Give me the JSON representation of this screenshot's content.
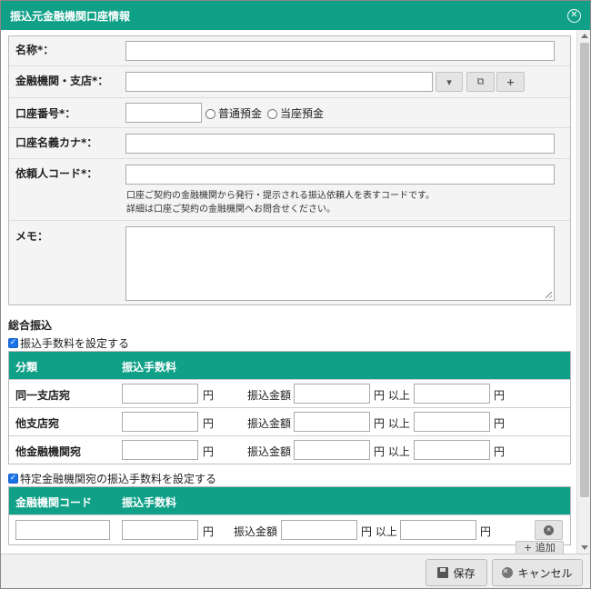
{
  "dialog": {
    "title": "振込元金融機関口座情報"
  },
  "form": {
    "name_label": "名称*：",
    "bank_label": "金融機関・支店*：",
    "bank_buttons": [
      "▾",
      "⧉",
      "+"
    ],
    "account_no_label": "口座番号*：",
    "account_types": [
      "普通預金",
      "当座預金"
    ],
    "holder_kana_label": "口座名義カナ*：",
    "requester_code_label": "依頼人コード*：",
    "requester_note_1": "口座ご契約の金融機関から発行・提示される振込依頼人を表すコードです。",
    "requester_note_2": "詳細は口座ご契約の金融機関へお問合せください。",
    "memo_label": "メモ："
  },
  "general_transfer": {
    "section_title": "総合振込",
    "fee_checkbox_label": "振込手数料を設定する",
    "fee_checkbox_checked": true,
    "table_headers": [
      "分類",
      "振込手数料"
    ],
    "rows": [
      {
        "label": "同一支店宛"
      },
      {
        "label": "他支店宛"
      },
      {
        "label": "他金融機関宛"
      }
    ],
    "yen": "円",
    "amount_label": "振込金額",
    "yen_or_more": "円 以上"
  },
  "specific_bank": {
    "checkbox_label": "特定金融機関宛の振込手数料を設定する",
    "checkbox_checked": true,
    "table_headers": [
      "金融機関コード",
      "振込手数料"
    ],
    "yen": "円",
    "amount_label": "振込金額",
    "yen_or_more": "円 以上",
    "add_label": "追加"
  },
  "footer": {
    "save_label": "保存",
    "cancel_label": "キャンセル"
  },
  "colors": {
    "accent": "#10a088",
    "backdrop": "#4f5964"
  }
}
